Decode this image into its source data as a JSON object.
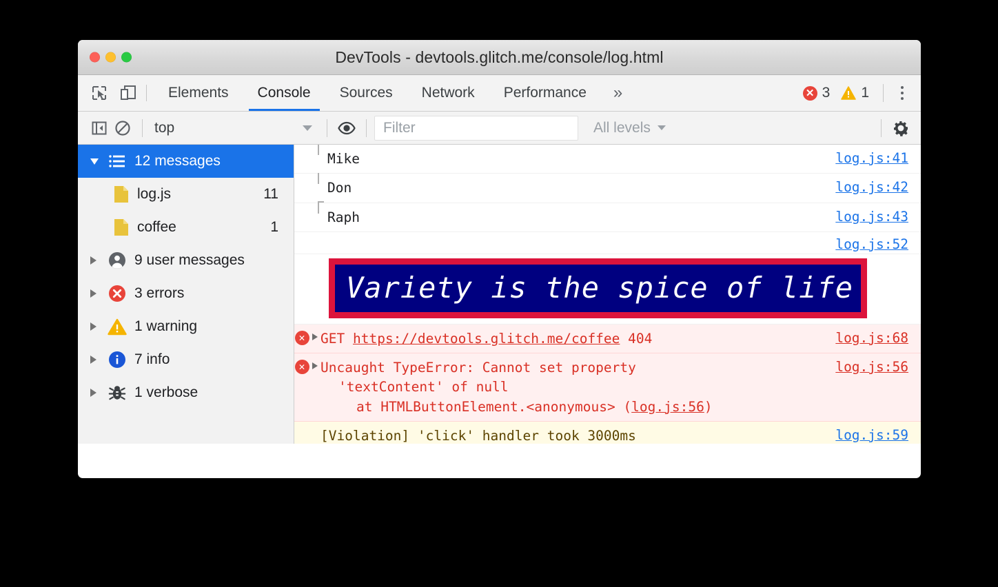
{
  "window": {
    "title": "DevTools - devtools.glitch.me/console/log.html",
    "traffic": {
      "close": "close-window",
      "minimize": "minimize-window",
      "zoom": "zoom-window"
    }
  },
  "tabbar": {
    "inspect_icon": "inspect-element-icon",
    "device_icon": "toggle-device-toolbar-icon",
    "tabs": [
      {
        "label": "Elements",
        "active": false
      },
      {
        "label": "Console",
        "active": true
      },
      {
        "label": "Sources",
        "active": false
      },
      {
        "label": "Network",
        "active": false
      },
      {
        "label": "Performance",
        "active": false
      }
    ],
    "more_label": "»",
    "error_count": "3",
    "warning_count": "1",
    "error_glyph": "✕",
    "warning_glyph": "!",
    "kebab_name": "more-options"
  },
  "filterbar": {
    "sidebar_toggle_icon": "show-console-sidebar-icon",
    "clear_icon": "clear-console-icon",
    "context": "top",
    "eye_icon": "create-live-expression-icon",
    "filter_placeholder": "Filter",
    "filter_value": "",
    "levels": "All levels",
    "settings_icon": "settings-gear-icon"
  },
  "sidebar": {
    "items": [
      {
        "label": "12 messages",
        "count": "",
        "icon": "list-icon",
        "selected": true,
        "expanded": true,
        "level": 0
      },
      {
        "label": "log.js",
        "count": "11",
        "icon": "file-icon",
        "selected": false,
        "expanded": false,
        "level": 1
      },
      {
        "label": "coffee",
        "count": "1",
        "icon": "file-icon",
        "selected": false,
        "expanded": false,
        "level": 1
      },
      {
        "label": "9 user messages",
        "count": "",
        "icon": "user-icon",
        "selected": false,
        "expanded": false,
        "level": 0
      },
      {
        "label": "3 errors",
        "count": "",
        "icon": "error-icon",
        "selected": false,
        "expanded": false,
        "level": 0
      },
      {
        "label": "1 warning",
        "count": "",
        "icon": "warning-icon",
        "selected": false,
        "expanded": false,
        "level": 0
      },
      {
        "label": "7 info",
        "count": "",
        "icon": "info-icon",
        "selected": false,
        "expanded": false,
        "level": 0
      },
      {
        "label": "1 verbose",
        "count": "",
        "icon": "bug-icon",
        "selected": false,
        "expanded": false,
        "level": 0
      }
    ]
  },
  "console": {
    "messages": [
      {
        "text": "Mike",
        "source": "log.js:41"
      },
      {
        "text": "Don",
        "source": "log.js:42"
      },
      {
        "text": "Raph",
        "source": "log.js:43"
      }
    ],
    "banner": {
      "source": "log.js:52",
      "text": "Variety is the spice of life",
      "background_color": "#000080",
      "border_color": "#dc143c",
      "text_color": "#ffffff"
    },
    "errors": [
      {
        "prefix": "GET",
        "url": "https://devtools.glitch.me/coffee",
        "status": "404",
        "source": "log.js:68"
      }
    ],
    "type_error": {
      "line1": "Uncaught TypeError: Cannot set property",
      "line2": "'textContent' of null",
      "line3_before": "at HTMLButtonElement.<anonymous> (",
      "line3_link": "log.js:56",
      "line3_after": ")",
      "source": "log.js:56"
    },
    "violation": {
      "text": "[Violation] 'click' handler took 3000ms",
      "source": "log.js:59"
    },
    "prompt_glyph": ">"
  },
  "colors": {
    "accent": "#1a73e8",
    "error": "#d93025",
    "error_badge": "#e8443a",
    "warning": "#f5b300",
    "error_row_bg": "#fff0f0",
    "violation_row_bg": "#fffbe5"
  }
}
